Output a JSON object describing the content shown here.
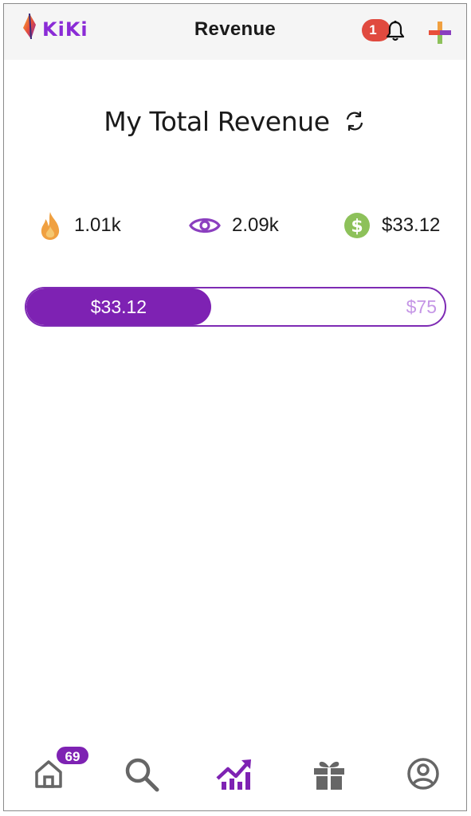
{
  "header": {
    "logo_text": "KiKi",
    "title": "Revenue",
    "notification_count": "1",
    "icons": [
      "kiki-logo-icon",
      "bell-icon",
      "plus-icon"
    ]
  },
  "revenue": {
    "heading": "My Total Revenue",
    "refresh_icon": "refresh-icon"
  },
  "stats": {
    "fire": {
      "icon": "fire-icon",
      "value": "1.01k",
      "color": "#f0a040"
    },
    "views": {
      "icon": "eye-icon",
      "value": "2.09k",
      "color": "#8b3fbf"
    },
    "earnings": {
      "icon": "dollar-icon",
      "value": "$33.12",
      "color": "#8dc15a"
    }
  },
  "progress": {
    "current_label": "$33.12",
    "target_label": "$75",
    "current_value": 33.12,
    "target_value": 75,
    "fill_color": "#7e22b3"
  },
  "bottom_nav": {
    "home_badge": "69",
    "items": [
      {
        "name": "home",
        "icon": "home-icon"
      },
      {
        "name": "search",
        "icon": "search-icon"
      },
      {
        "name": "stats",
        "icon": "trending-up-icon",
        "active": true
      },
      {
        "name": "gifts",
        "icon": "gift-icon"
      },
      {
        "name": "profile",
        "icon": "user-circle-icon"
      }
    ]
  },
  "colors": {
    "accent": "#7e22b3",
    "badge_red": "#e04a3f",
    "header_bg": "#f5f5f5",
    "inactive_icon": "#666666"
  }
}
